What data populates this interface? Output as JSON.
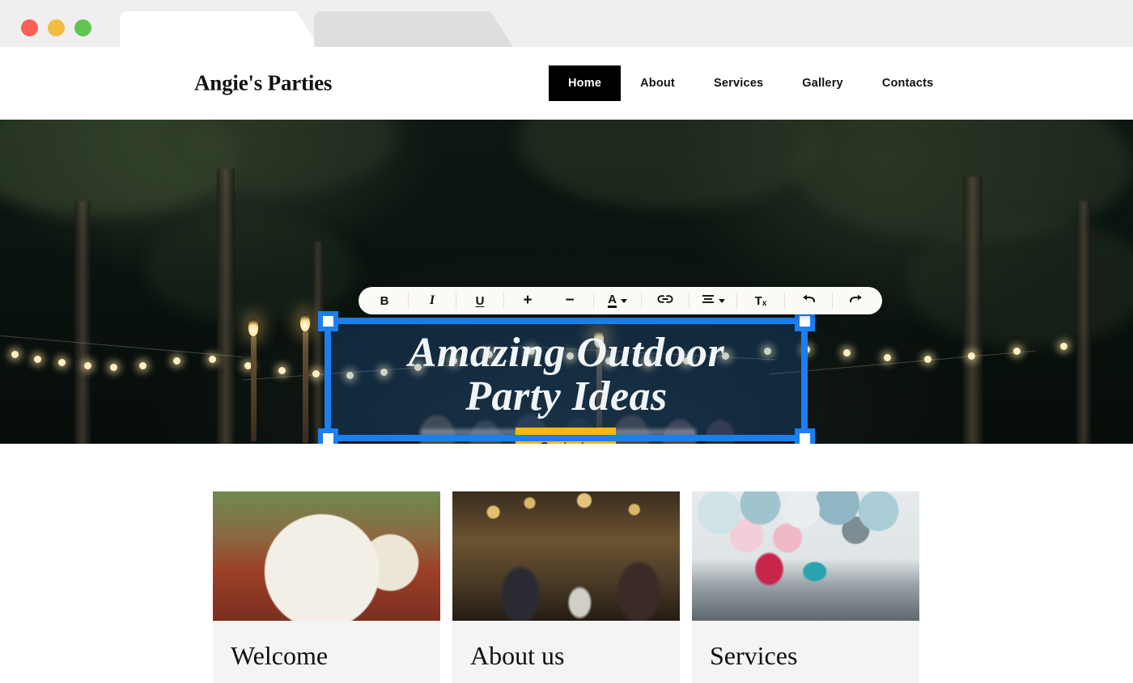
{
  "browser": {
    "traffic_lights": [
      {
        "name": "close",
        "color": "#ff5f56"
      },
      {
        "name": "minimize",
        "color": "#f0bd41"
      },
      {
        "name": "maximize",
        "color": "#61c council"
      }
    ],
    "tabs": [
      {
        "label": "",
        "active": true
      },
      {
        "label": "",
        "active": false
      }
    ]
  },
  "site": {
    "logo": "Angie's Parties",
    "nav": [
      {
        "label": "Home",
        "active": true
      },
      {
        "label": "About",
        "active": false
      },
      {
        "label": "Services",
        "active": false
      },
      {
        "label": "Gallery",
        "active": false
      },
      {
        "label": "Contacts",
        "active": false
      }
    ]
  },
  "hero": {
    "title_line1": "Amazing Outdoor",
    "title_line2": "Party Ideas",
    "cta_label": "Contacts",
    "cta_color": "#fab70c",
    "selection_color": "#1a7ff0"
  },
  "toolbar": {
    "items": [
      {
        "icon": "bold-icon",
        "label": "B"
      },
      {
        "icon": "italic-icon",
        "label": "I"
      },
      {
        "icon": "underline-icon",
        "label": "U"
      },
      {
        "icon": "increase-font-size-icon",
        "label": "+"
      },
      {
        "icon": "decrease-font-size-icon",
        "label": "−"
      },
      {
        "icon": "text-color-icon",
        "label": "A"
      },
      {
        "icon": "link-icon",
        "label": ""
      },
      {
        "icon": "align-icon",
        "label": ""
      },
      {
        "icon": "clear-formatting-icon",
        "label": "T",
        "sub": "x"
      },
      {
        "icon": "undo-icon",
        "label": "←"
      },
      {
        "icon": "redo-icon",
        "label": "→"
      }
    ]
  },
  "cards": [
    {
      "title": "Welcome",
      "art": "art-food",
      "image_name": "food-plate-photo"
    },
    {
      "title": "About us",
      "art": "art-cheers",
      "image_name": "people-toasting-photo"
    },
    {
      "title": "Services",
      "art": "art-sweets",
      "image_name": "dessert-table-photo"
    }
  ]
}
